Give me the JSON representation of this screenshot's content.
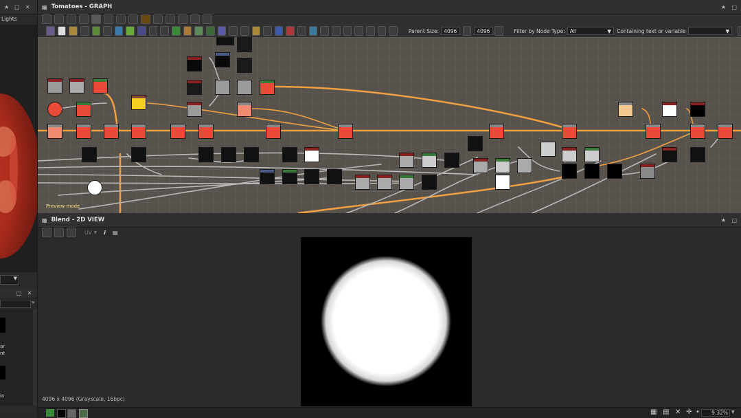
{
  "left_panel": {
    "title": "Lights",
    "list_labels": [
      "ar",
      "nt",
      "in"
    ]
  },
  "graph_panel": {
    "title": "Tomatoes - GRAPH",
    "parent_size_label": "Parent Size:",
    "parent_size_value": "4096",
    "output_size_value": "4096",
    "filter_label": "Filter by Node Type:",
    "filter_value": "All",
    "containing_label": "Containing text or variable",
    "containing_value": "",
    "preview_mode": "Preview mode"
  },
  "view2d_panel": {
    "title": "Blend - 2D VIEW",
    "uv_label": "UV",
    "image_info": "4096 x 4096 (Grayscale, 16bpc)",
    "zoom_value": "9.32%"
  },
  "colors": {
    "graph_bg": "#58524c",
    "link_orange": "#f0a040",
    "link_gray": "#b8b8b8",
    "panel_bg": "#303030"
  }
}
